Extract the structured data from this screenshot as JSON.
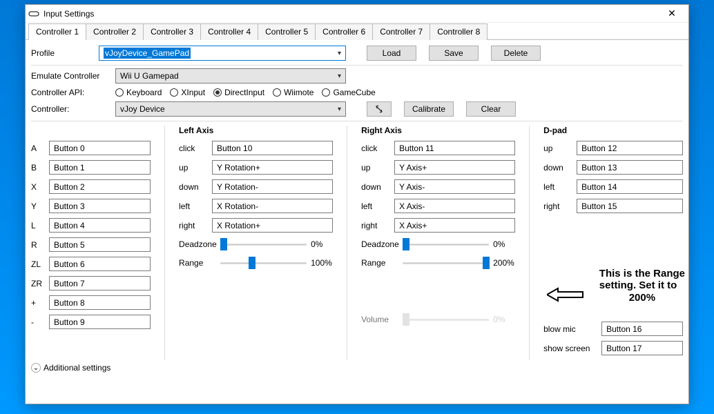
{
  "window": {
    "title": "Input Settings"
  },
  "tabs": [
    "Controller 1",
    "Controller 2",
    "Controller 3",
    "Controller 4",
    "Controller 5",
    "Controller 6",
    "Controller 7",
    "Controller 8"
  ],
  "profile": {
    "label": "Profile",
    "value": "vJoyDevice_GamePad",
    "load": "Load",
    "save": "Save",
    "delete": "Delete"
  },
  "emulate": {
    "label": "Emulate Controller",
    "value": "Wii U Gamepad"
  },
  "api": {
    "label": "Controller API:",
    "options": [
      "Keyboard",
      "XInput",
      "DirectInput",
      "Wiimote",
      "GameCube"
    ],
    "selected": "DirectInput"
  },
  "device": {
    "label": "Controller:",
    "value": "vJoy Device",
    "calibrate": "Calibrate",
    "clear": "Clear"
  },
  "buttons": [
    {
      "label": "A",
      "value": "Button 0"
    },
    {
      "label": "B",
      "value": "Button 1"
    },
    {
      "label": "X",
      "value": "Button 2"
    },
    {
      "label": "Y",
      "value": "Button 3"
    },
    {
      "label": "L",
      "value": "Button 4"
    },
    {
      "label": "R",
      "value": "Button 5"
    },
    {
      "label": "ZL",
      "value": "Button 6"
    },
    {
      "label": "ZR",
      "value": "Button 7"
    },
    {
      "label": "+",
      "value": "Button 8"
    },
    {
      "label": "-",
      "value": "Button 9"
    }
  ],
  "leftAxis": {
    "header": "Left Axis",
    "rows": [
      {
        "label": "click",
        "value": "Button 10"
      },
      {
        "label": "up",
        "value": "Y Rotation+"
      },
      {
        "label": "down",
        "value": "Y Rotation-"
      },
      {
        "label": "left",
        "value": "X Rotation-"
      },
      {
        "label": "right",
        "value": "X Rotation+"
      }
    ],
    "deadzone_label": "Deadzone",
    "deadzone_val": "0%",
    "range_label": "Range",
    "range_val": "100%"
  },
  "rightAxis": {
    "header": "Right Axis",
    "rows": [
      {
        "label": "click",
        "value": "Button 11"
      },
      {
        "label": "up",
        "value": "Y Axis+"
      },
      {
        "label": "down",
        "value": "Y Axis-"
      },
      {
        "label": "left",
        "value": "X Axis-"
      },
      {
        "label": "right",
        "value": "X Axis+"
      }
    ],
    "deadzone_label": "Deadzone",
    "deadzone_val": "0%",
    "range_label": "Range",
    "range_val": "200%",
    "volume_label": "Volume",
    "volume_val": "0%"
  },
  "dpad": {
    "header": "D-pad",
    "rows": [
      {
        "label": "up",
        "value": "Button 12"
      },
      {
        "label": "down",
        "value": "Button 13"
      },
      {
        "label": "left",
        "value": "Button 14"
      },
      {
        "label": "right",
        "value": "Button 15"
      }
    ],
    "blow_label": "blow mic",
    "blow_value": "Button 16",
    "show_label": "show screen",
    "show_value": "Button 17"
  },
  "additional": "Additional settings",
  "annotation": "This is the Range setting. Set it to 200%"
}
